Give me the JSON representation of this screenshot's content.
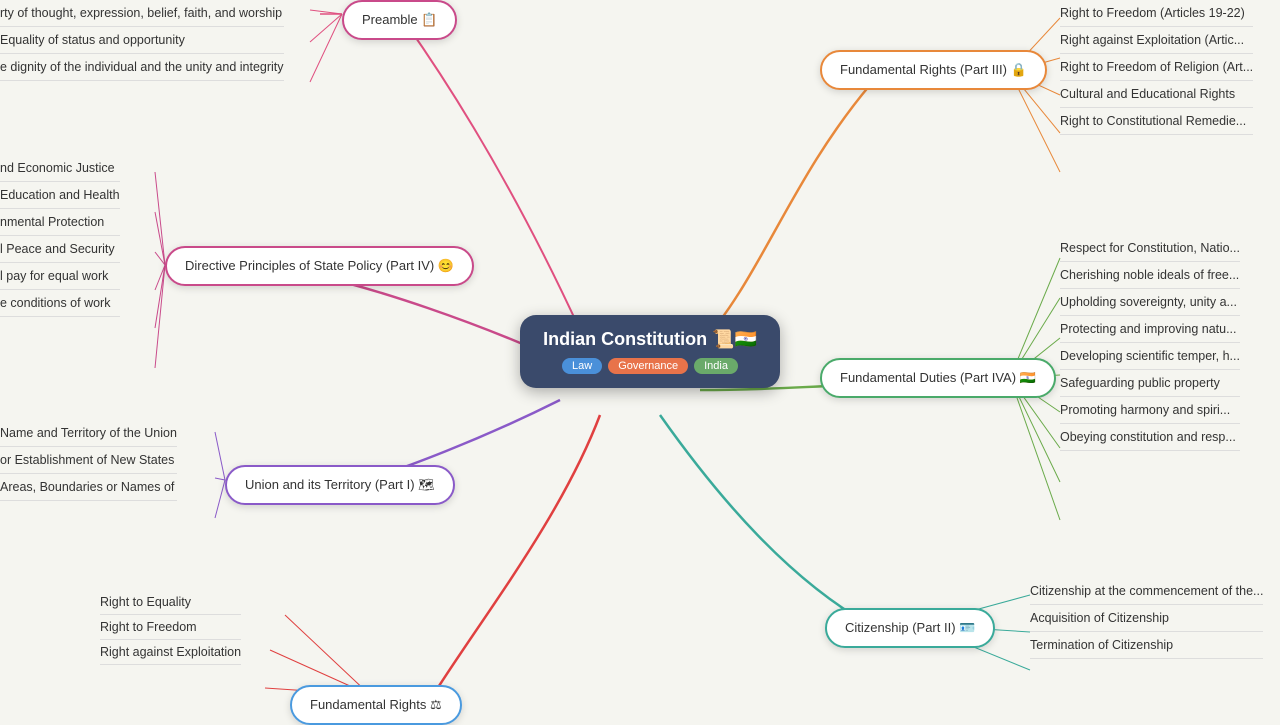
{
  "central": {
    "title": "Indian Constitution 📜🇮🇳",
    "tags": [
      "Law",
      "Governance",
      "India"
    ]
  },
  "branches": {
    "preamble": "Preamble 📋",
    "fundamentalRights": "Fundamental Rights (Part III) 🔒",
    "directivePrinciples": "Directive Principles of State Policy (Part IV) 😊",
    "fundamentalDuties": "Fundamental Duties (Part IVA) 🇮🇳",
    "unionTerritory": "Union and its Territory (Part I) 🗺",
    "citizenship": "Citizenship (Part II) 🪪",
    "fundamentalRights2": "Fundamental Rights ⚖"
  },
  "leaves": {
    "preamble": [
      "rty of thought, expression, belief, faith, and worship",
      "Equality of status and opportunity",
      "e dignity of the individual and the unity and integrity"
    ],
    "directive": [
      "nd Economic Justice",
      "Education and Health",
      "nmental Protection",
      "l Peace and Security",
      "l pay for equal work",
      "e conditions of work"
    ],
    "union": [
      "Name and Territory of the Union",
      "or Establishment of New States",
      "Areas, Boundaries or Names of"
    ],
    "fundamentalRights": [
      "Right to Freedom (Articles 19-22)",
      "Right against Exploitation (Artic...",
      "Right to Freedom of Religion (Art...",
      "Cultural and Educational Rights",
      "Right to Constitutional Remedie..."
    ],
    "duties": [
      "Respect for Constitution, Natio...",
      "Cherishing noble ideals of free...",
      "Upholding sovereignty, unity a...",
      "Protecting and improving natu...",
      "Developing scientific temper, h...",
      "Safeguarding public property",
      "Promoting harmony and spiri...",
      "Obeying constitution and resp..."
    ],
    "citizenship": [
      "Citizenship at the commencement of the...",
      "Acquisition of Citizenship",
      "Termination of Citizenship"
    ],
    "fundamentalRights2": [
      "Right to Equality",
      "Right to Freedom",
      "Right against Exploitation"
    ]
  }
}
